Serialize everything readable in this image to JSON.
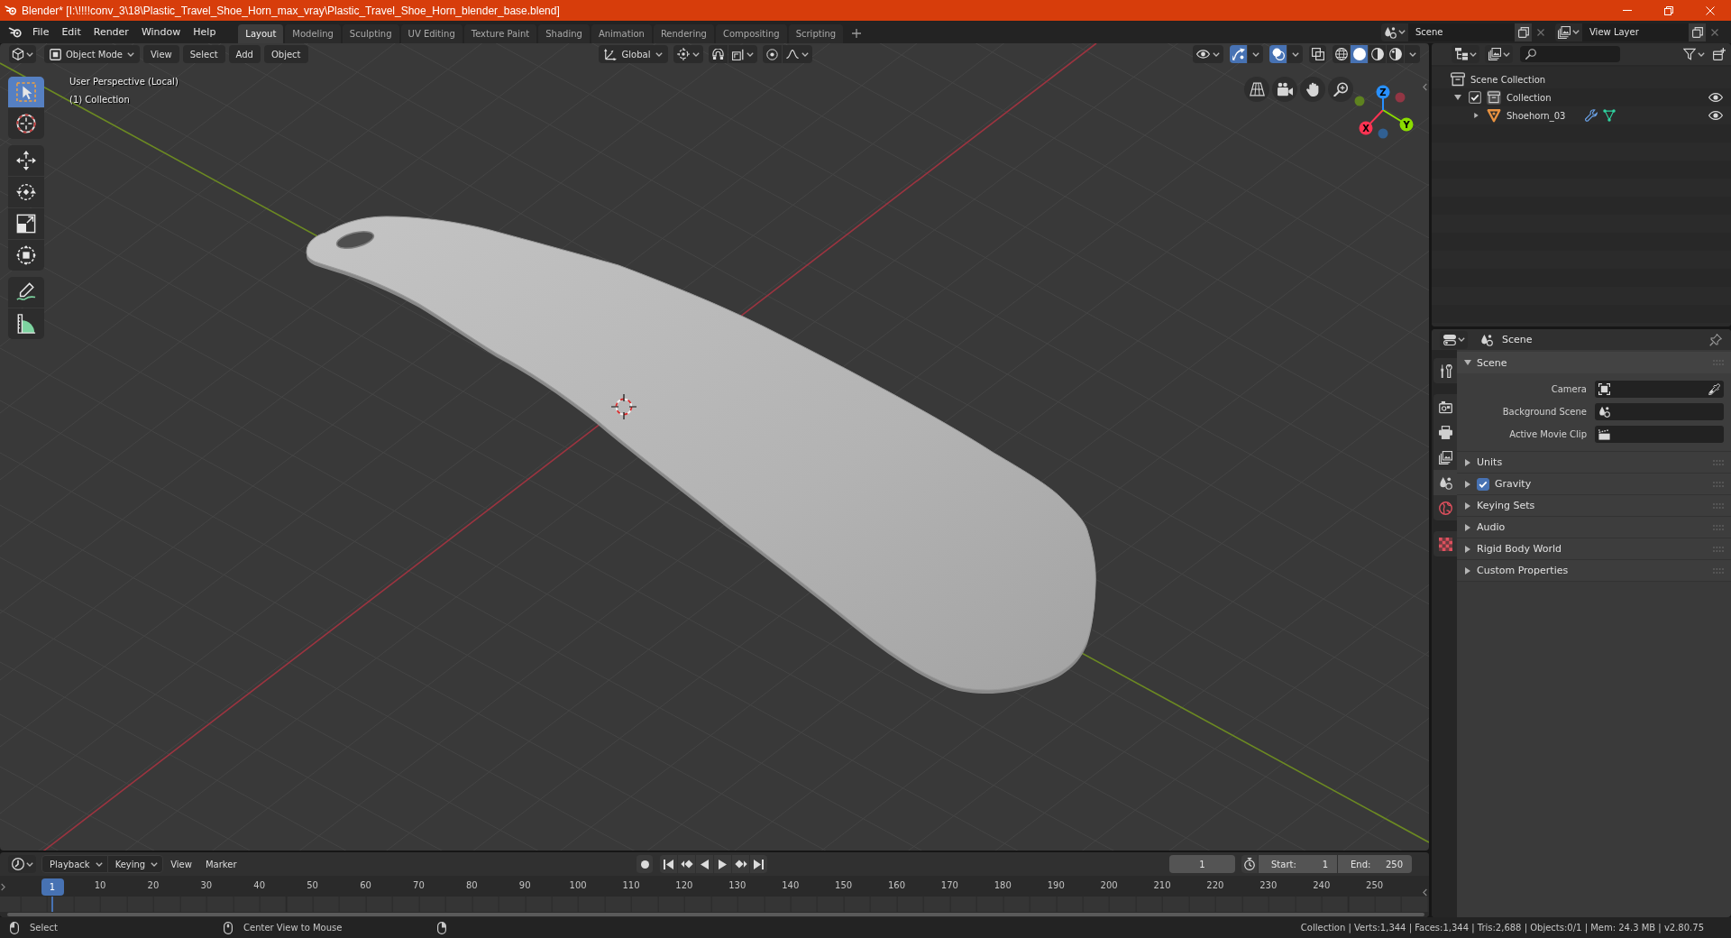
{
  "window": {
    "title": "Blender* [I:\\!!!!conv_3\\18\\Plastic_Travel_Shoe_Horn_max_vray\\Plastic_Travel_Shoe_Horn_blender_base.blend]"
  },
  "top_bar": {
    "menus": [
      "File",
      "Edit",
      "Render",
      "Window",
      "Help"
    ],
    "workspace_tabs": [
      {
        "label": "Layout",
        "selected": true
      },
      {
        "label": "Modeling",
        "selected": false
      },
      {
        "label": "Sculpting",
        "selected": false
      },
      {
        "label": "UV Editing",
        "selected": false
      },
      {
        "label": "Texture Paint",
        "selected": false
      },
      {
        "label": "Shading",
        "selected": false
      },
      {
        "label": "Animation",
        "selected": false
      },
      {
        "label": "Rendering",
        "selected": false
      },
      {
        "label": "Compositing",
        "selected": false
      },
      {
        "label": "Scripting",
        "selected": false
      }
    ],
    "scene": "Scene",
    "view_layer": "View Layer"
  },
  "viewport": {
    "header": {
      "mode": "Object Mode",
      "menus": [
        "View",
        "Select",
        "Add",
        "Object"
      ],
      "orientation": "Global",
      "toggles": [
        {
          "kind": "gizmo",
          "on": true
        },
        {
          "kind": "overlay",
          "on": true
        },
        {
          "kind": "xray",
          "on": false
        }
      ],
      "shading": [
        {
          "kind": "wireframe",
          "selected": false
        },
        {
          "kind": "solid",
          "selected": true
        },
        {
          "kind": "material",
          "selected": false
        },
        {
          "kind": "rendered",
          "selected": false
        }
      ]
    },
    "tool_groups": [
      [
        {
          "kind": "select",
          "selected": true
        },
        {
          "kind": "cursor",
          "selected": false
        }
      ],
      [
        {
          "kind": "move",
          "selected": false
        },
        {
          "kind": "rotate",
          "selected": false
        },
        {
          "kind": "scale",
          "selected": false
        },
        {
          "kind": "transform",
          "selected": false
        }
      ],
      [
        {
          "kind": "annotate",
          "selected": false
        },
        {
          "kind": "measure",
          "selected": false
        }
      ]
    ],
    "info": [
      "User Perspective (Local)",
      "(1) Collection"
    ],
    "gizmo_axes": [
      {
        "label": "X",
        "color": "#ff3352"
      },
      {
        "label": "Y",
        "color": "#8bdc00"
      },
      {
        "label": "Z",
        "color": "#2890ff"
      }
    ]
  },
  "outliner": {
    "tree": [
      {
        "label": "Scene Collection",
        "kind": "scene",
        "active": false,
        "children": [
          {
            "label": "Collection",
            "kind": "collection",
            "active": true,
            "expanded": true,
            "checked": true,
            "visible": true,
            "children": [
              {
                "label": "Shoehorn_03",
                "kind": "mesh",
                "active": false,
                "expanded": false,
                "visible": true
              }
            ]
          }
        ]
      }
    ]
  },
  "properties": {
    "context": "Scene",
    "tab_groups": [
      [
        {
          "kind": "tool",
          "selected": false
        }
      ],
      [
        {
          "kind": "render",
          "selected": false
        },
        {
          "kind": "output",
          "selected": false
        },
        {
          "kind": "viewlayer",
          "selected": false
        },
        {
          "kind": "scene",
          "selected": true
        },
        {
          "kind": "world",
          "selected": false
        }
      ],
      [
        {
          "kind": "texture",
          "selected": false
        }
      ]
    ],
    "panels": [
      {
        "label": "Scene",
        "expanded": true,
        "fields": [
          {
            "label": "Camera",
            "kind": "camera"
          },
          {
            "label": "Background Scene",
            "kind": "scene"
          },
          {
            "label": "Active Movie Clip",
            "kind": "clip"
          }
        ]
      },
      {
        "label": "Units",
        "expanded": false
      },
      {
        "label": "Gravity",
        "expanded": false,
        "toggle": {
          "checked": true
        }
      },
      {
        "label": "Keying Sets",
        "expanded": false
      },
      {
        "label": "Audio",
        "expanded": false
      },
      {
        "label": "Rigid Body World",
        "expanded": false
      },
      {
        "label": "Custom Properties",
        "expanded": false
      }
    ]
  },
  "timeline": {
    "dropdowns": [
      "Playback",
      "Keying"
    ],
    "menus": [
      "View",
      "Marker"
    ],
    "current_frame": "1",
    "start": {
      "label": "Start:",
      "value": "1"
    },
    "end": {
      "label": "End:",
      "value": "250"
    },
    "ruler": {
      "current": "1",
      "labels": [
        "10",
        "20",
        "30",
        "40",
        "50",
        "60",
        "70",
        "80",
        "90",
        "100",
        "110",
        "120",
        "130",
        "140",
        "150",
        "160",
        "170",
        "180",
        "190",
        "200",
        "210",
        "220",
        "230",
        "240",
        "250"
      ]
    }
  },
  "status_bar": {
    "hints": [
      {
        "kind": "left",
        "label": "Select"
      },
      {
        "kind": "middle",
        "label": "Center View to Mouse"
      },
      {
        "kind": "right"
      }
    ],
    "stats": "Collection | Verts:1,344 | Faces:1,344 | Tris:2,688 | Objects:0/1 | Mem: 24.3 MB | v2.80.75"
  }
}
